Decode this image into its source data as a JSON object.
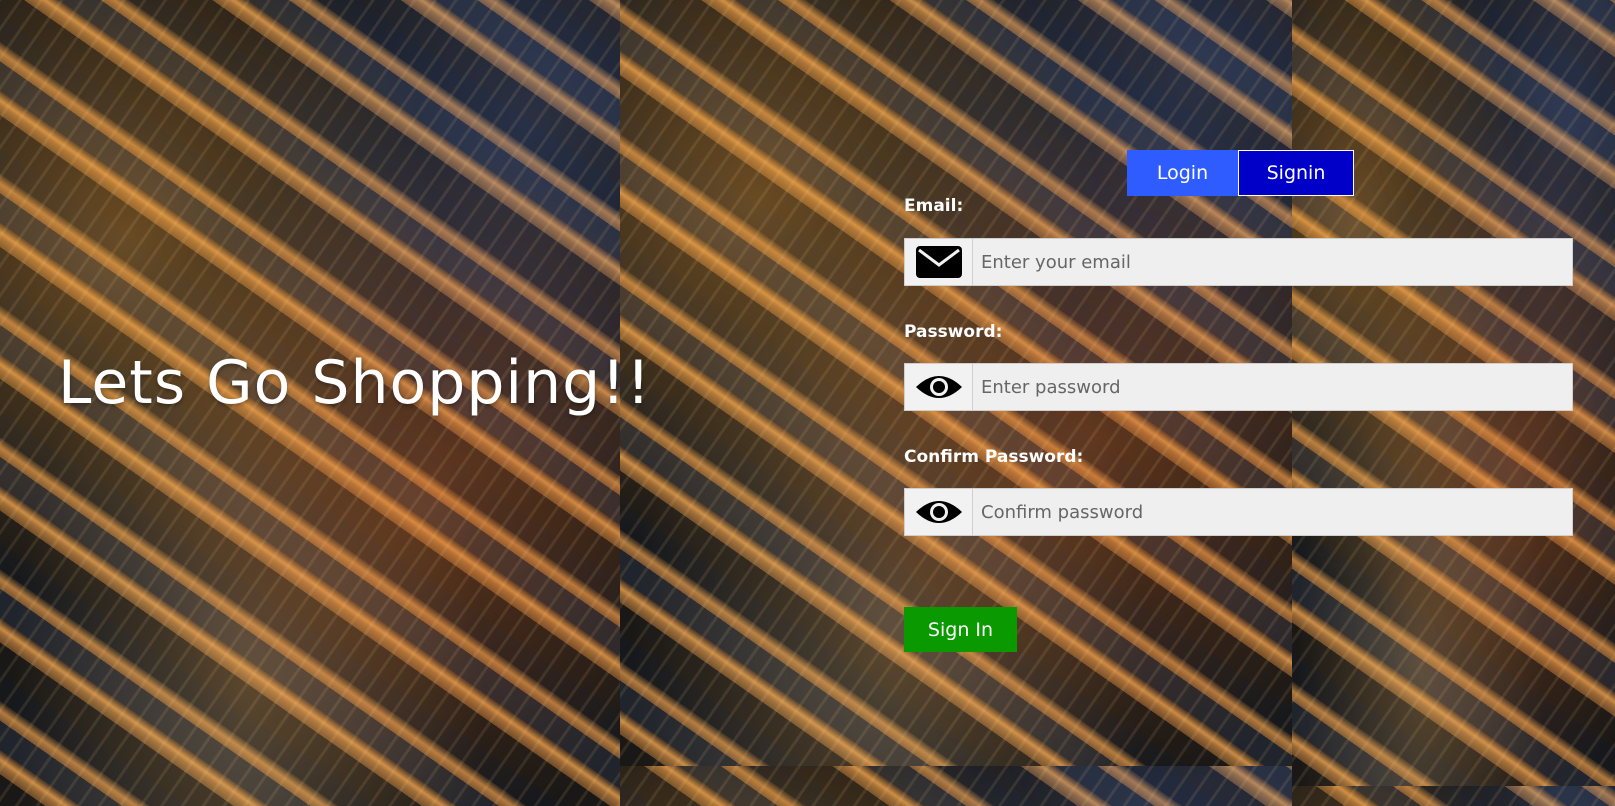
{
  "hero": {
    "title": "Lets Go Shopping!!"
  },
  "tabs": {
    "login_label": "Login",
    "signin_label": "Signin"
  },
  "form": {
    "email_label": "Email:",
    "email_placeholder": "Enter your email",
    "email_icon": "envelope-icon",
    "password_label": "Password:",
    "password_placeholder": "Enter password",
    "password_icon": "eye-icon",
    "confirm_label": "Confirm Password:",
    "confirm_placeholder": "Confirm password",
    "confirm_icon": "eye-icon",
    "submit_label": "Sign In"
  },
  "colors": {
    "login_tab": "#2f5cff",
    "signin_tab": "#0000c8",
    "submit_button": "#0a9a00",
    "text": "#ffffff"
  }
}
